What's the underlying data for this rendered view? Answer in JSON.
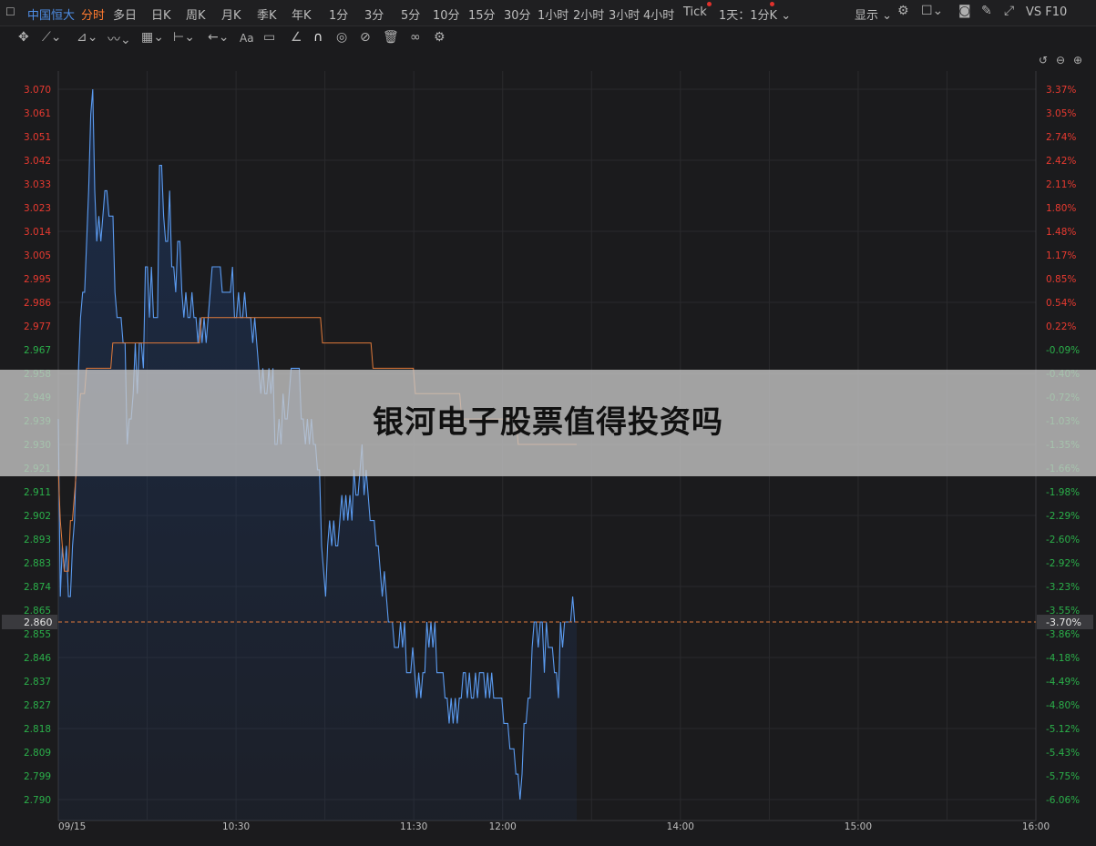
{
  "topbar": {
    "symbol": "中国恒大",
    "period_tabs": [
      "分时",
      "多日",
      "日K",
      "周K",
      "月K",
      "季K",
      "年K",
      "1分",
      "3分",
      "5分",
      "10分",
      "15分",
      "30分",
      "1小时",
      "2小时",
      "3小时",
      "4小时",
      "Tick"
    ],
    "active_tab": "分时",
    "combo": "1天：1分K",
    "display_label": "显示",
    "f10_label": "VS F10"
  },
  "toolbar": {
    "icons": [
      "move-icon",
      "line-icon",
      "fib-icon",
      "wave-icon",
      "gann-icon",
      "range-icon",
      "arrow-icon",
      "text-icon",
      "note-icon",
      "ruler-icon",
      "magnet-icon",
      "eye-icon",
      "hide-icon",
      "trash-icon",
      "link-icon",
      "settings-icon"
    ]
  },
  "chart_controls": {
    "icons": [
      "reset-icon",
      "zoom-out-icon",
      "zoom-in-icon"
    ]
  },
  "banner": {
    "title": "银河电子股票值得投资吗"
  },
  "colors": {
    "price_line": "#5b9bf0",
    "avg_line": "#e07a3a",
    "up": "#e83a30",
    "down": "#2bb04a",
    "ref_line": "#e07a3a"
  },
  "chart_data": {
    "type": "line",
    "x_ticks": [
      "09/15",
      "10:30",
      "11:30",
      "12:00",
      "14:00",
      "15:00",
      "16:00"
    ],
    "x_tick_minutes": [
      570,
      630,
      690,
      720,
      780,
      840,
      900
    ],
    "session_minutes": [
      570,
      900
    ],
    "price_ticks": [
      "3.070",
      "3.061",
      "3.051",
      "3.042",
      "3.033",
      "3.023",
      "3.014",
      "3.005",
      "2.995",
      "2.986",
      "2.977",
      "2.967",
      "2.958",
      "2.949",
      "2.939",
      "2.930",
      "2.921",
      "2.911",
      "2.902",
      "2.893",
      "2.883",
      "2.874",
      "2.865",
      "2.855",
      "2.846",
      "2.837",
      "2.827",
      "2.818",
      "2.809",
      "2.799",
      "2.790"
    ],
    "pct_ticks": [
      "3.37%",
      "3.05%",
      "2.74%",
      "2.42%",
      "2.11%",
      "1.80%",
      "1.48%",
      "1.17%",
      "0.85%",
      "0.54%",
      "0.22%",
      "-0.09%",
      "-0.40%",
      "-0.72%",
      "-1.03%",
      "-1.35%",
      "-1.66%",
      "-1.98%",
      "-2.29%",
      "-2.60%",
      "-2.92%",
      "-3.23%",
      "-3.55%",
      "-3.86%",
      "-4.18%",
      "-4.49%",
      "-4.80%",
      "-5.12%",
      "-5.43%",
      "-5.75%",
      "-6.06%"
    ],
    "ylim": [
      2.79,
      3.07
    ],
    "current_price": "2.860",
    "current_pct": "-3.70%",
    "series": [
      {
        "values": [
          2.94,
          2.87,
          2.89,
          2.88,
          2.89,
          2.87,
          2.87,
          2.89,
          2.9,
          2.93,
          2.96,
          2.98,
          2.99,
          2.99,
          3.01,
          3.03,
          3.06,
          3.07,
          3.03,
          3.01,
          3.02,
          3.01,
          3.02,
          3.03,
          3.03,
          3.02,
          3.02,
          3.02,
          2.99,
          2.98,
          2.98,
          2.98,
          2.97,
          2.97,
          2.93,
          2.94,
          2.94,
          2.95,
          2.97,
          2.95,
          2.97,
          2.97,
          2.96,
          3.0,
          3.0,
          2.98,
          3.0,
          2.98,
          2.98,
          2.98,
          3.04,
          3.04,
          3.02,
          3.01,
          3.01,
          3.03,
          3.0,
          3.0,
          2.99,
          3.01,
          3.01,
          2.99,
          2.98,
          2.99,
          2.98,
          2.98,
          2.99,
          2.98,
          2.98,
          2.97,
          2.98,
          2.97,
          2.98,
          2.97,
          2.98,
          2.99,
          3.0,
          3.0,
          3.0,
          3.0,
          3.0,
          2.99,
          2.99,
          2.99,
          2.99,
          2.99,
          3.0,
          2.98,
          2.98,
          2.99,
          2.98,
          2.98,
          2.99,
          2.98,
          2.98,
          2.98,
          2.97,
          2.98,
          2.97,
          2.96,
          2.95,
          2.96,
          2.95,
          2.95,
          2.96,
          2.95,
          2.96,
          2.93,
          2.93,
          2.94,
          2.93,
          2.95,
          2.94,
          2.94,
          2.95,
          2.96,
          2.96,
          2.96,
          2.96,
          2.96,
          2.94,
          2.94,
          2.93,
          2.94,
          2.93,
          2.94,
          2.93,
          2.93,
          2.92,
          2.92,
          2.89,
          2.88,
          2.87,
          2.89,
          2.9,
          2.89,
          2.9,
          2.89,
          2.89,
          2.9,
          2.91,
          2.9,
          2.91,
          2.9,
          2.91,
          2.9,
          2.92,
          2.91,
          2.91,
          2.92,
          2.93,
          2.91,
          2.92,
          2.91,
          2.9,
          2.9,
          2.9,
          2.89,
          2.89,
          2.88,
          2.87,
          2.88,
          2.87,
          2.86,
          2.86,
          2.86,
          2.85,
          2.85,
          2.85,
          2.86,
          2.85,
          2.86,
          2.84,
          2.84,
          2.84,
          2.85,
          2.84,
          2.83,
          2.84,
          2.83,
          2.84,
          2.84,
          2.86,
          2.85,
          2.86,
          2.85,
          2.86,
          2.84,
          2.84,
          2.84,
          2.84,
          2.83,
          2.83,
          2.82,
          2.83,
          2.82,
          2.83,
          2.82,
          2.83,
          2.83,
          2.84,
          2.84,
          2.83,
          2.84,
          2.83,
          2.83,
          2.84,
          2.83,
          2.84,
          2.84,
          2.84,
          2.83,
          2.84,
          2.83,
          2.84,
          2.83,
          2.83,
          2.83,
          2.83,
          2.83,
          2.82,
          2.82,
          2.82,
          2.81,
          2.81,
          2.81,
          2.8,
          2.8,
          2.79,
          2.8,
          2.82,
          2.82,
          2.83,
          2.83,
          2.85,
          2.86,
          2.86,
          2.85,
          2.86,
          2.86,
          2.84,
          2.86,
          2.85,
          2.85,
          2.85,
          2.84,
          2.84,
          2.83,
          2.86,
          2.85,
          2.86,
          2.86,
          2.86,
          2.86,
          2.87,
          2.86,
          2.86
        ]
      },
      {
        "values": [
          2.92,
          2.9,
          2.89,
          2.88,
          2.88,
          2.88,
          2.9,
          2.9,
          2.91,
          2.92,
          2.94,
          2.95,
          2.95,
          2.95,
          2.96,
          2.96,
          2.96,
          2.96,
          2.96,
          2.96,
          2.96,
          2.96,
          2.96,
          2.96,
          2.96,
          2.96,
          2.96,
          2.97,
          2.97,
          2.97,
          2.97,
          2.97,
          2.97,
          2.97,
          2.97,
          2.97,
          2.97,
          2.97,
          2.97,
          2.97,
          2.97,
          2.97,
          2.97,
          2.97,
          2.97,
          2.97,
          2.97,
          2.97,
          2.97,
          2.97,
          2.97,
          2.97,
          2.97,
          2.97,
          2.97,
          2.97,
          2.97,
          2.97,
          2.97,
          2.97,
          2.97,
          2.97,
          2.97,
          2.97,
          2.97,
          2.97,
          2.97,
          2.97,
          2.97,
          2.97,
          2.97,
          2.98,
          2.98,
          2.98,
          2.98,
          2.98,
          2.98,
          2.98,
          2.98,
          2.98,
          2.98,
          2.98,
          2.98,
          2.98,
          2.98,
          2.98,
          2.98,
          2.98,
          2.98,
          2.98,
          2.98,
          2.98,
          2.98,
          2.98,
          2.98,
          2.98,
          2.98,
          2.98,
          2.98,
          2.98,
          2.98,
          2.98,
          2.98,
          2.98,
          2.98,
          2.98,
          2.98,
          2.98,
          2.98,
          2.98,
          2.98,
          2.98,
          2.98,
          2.98,
          2.98,
          2.98,
          2.98,
          2.98,
          2.98,
          2.98,
          2.98,
          2.98,
          2.98,
          2.98,
          2.98,
          2.98,
          2.98,
          2.98,
          2.98,
          2.98,
          2.98,
          2.97,
          2.97,
          2.97,
          2.97,
          2.97,
          2.97,
          2.97,
          2.97,
          2.97,
          2.97,
          2.97,
          2.97,
          2.97,
          2.97,
          2.97,
          2.97,
          2.97,
          2.97,
          2.97,
          2.97,
          2.97,
          2.97,
          2.97,
          2.97,
          2.97,
          2.96,
          2.96,
          2.96,
          2.96,
          2.96,
          2.96,
          2.96,
          2.96,
          2.96,
          2.96,
          2.96,
          2.96,
          2.96,
          2.96,
          2.96,
          2.96,
          2.96,
          2.96,
          2.96,
          2.96,
          2.96,
          2.95,
          2.95,
          2.95,
          2.95,
          2.95,
          2.95,
          2.95,
          2.95,
          2.95,
          2.95,
          2.95,
          2.95,
          2.95,
          2.95,
          2.95,
          2.95,
          2.95,
          2.95,
          2.95,
          2.95,
          2.95,
          2.95,
          2.95,
          2.94,
          2.94,
          2.94,
          2.94,
          2.94,
          2.94,
          2.94,
          2.94,
          2.94,
          2.94,
          2.94,
          2.94,
          2.94,
          2.94,
          2.94,
          2.94,
          2.94,
          2.94,
          2.94,
          2.94,
          2.94,
          2.94,
          2.94,
          2.94,
          2.94,
          2.94,
          2.94,
          2.94,
          2.93,
          2.93,
          2.93,
          2.93,
          2.93,
          2.93,
          2.93,
          2.93,
          2.93,
          2.93,
          2.93,
          2.93,
          2.93,
          2.93,
          2.93,
          2.93,
          2.93,
          2.93,
          2.93,
          2.93,
          2.93,
          2.93,
          2.93,
          2.93,
          2.93,
          2.93,
          2.93,
          2.93,
          2.93,
          2.93
        ]
      }
    ]
  }
}
